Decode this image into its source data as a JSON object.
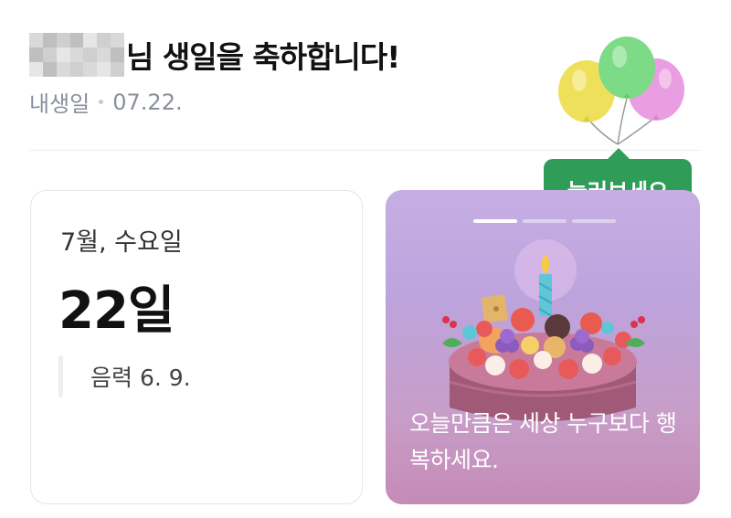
{
  "header": {
    "title_suffix": "님 생일을 축하합니다!",
    "subtitle_label": "내생일",
    "subtitle_date": "07.22."
  },
  "tooltip": {
    "label": "눌러보세요"
  },
  "date_card": {
    "month_weekday": "7월, 수요일",
    "day": "22일",
    "lunar": "음력 6. 9."
  },
  "story_card": {
    "message": "오늘만큼은 세상 누구보다 행복하세요.",
    "progress": {
      "total": 3,
      "current": 1
    }
  },
  "colors": {
    "tooltip_bg": "#2f9d57",
    "card_gradient_top": "#c6aee3",
    "card_gradient_bottom": "#c58bb7",
    "balloon_yellow": "#eee05a",
    "balloon_green": "#7ddb87",
    "balloon_pink": "#e89ee0"
  },
  "icons": [
    "balloons-icon",
    "birthday-cake-icon"
  ]
}
